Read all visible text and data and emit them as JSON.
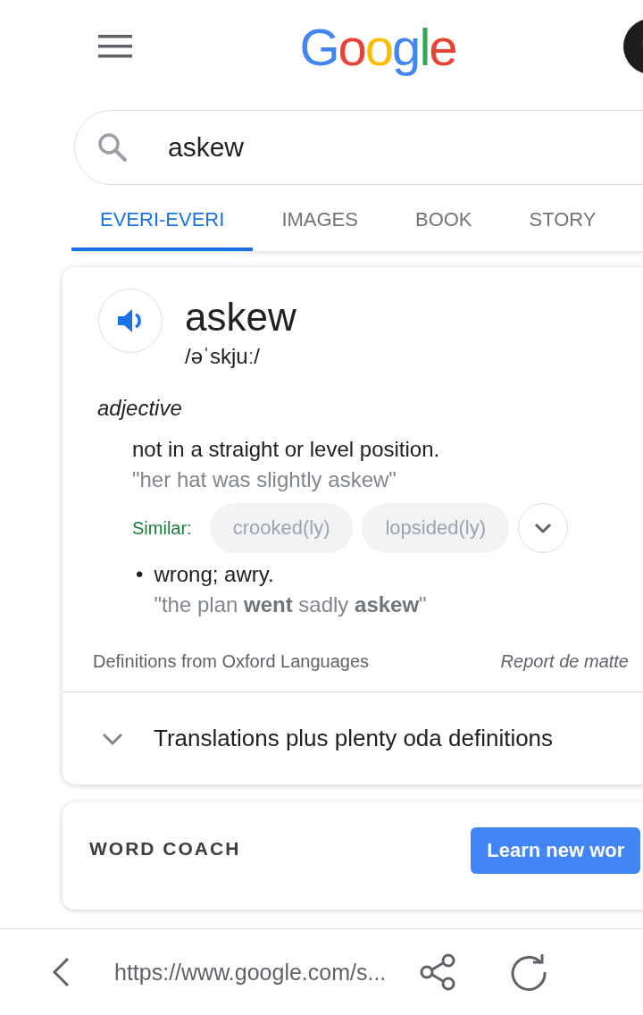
{
  "header": {
    "logo": "Google"
  },
  "search": {
    "value": "askew"
  },
  "tabs": [
    {
      "label": "EVERI-EVERI",
      "selected": true
    },
    {
      "label": "IMAGES",
      "selected": false
    },
    {
      "label": "BOOK",
      "selected": false
    },
    {
      "label": "STORY",
      "selected": false
    }
  ],
  "definition": {
    "word": "askew",
    "phonetic": "/əˈskjuː/",
    "part_of_speech": "adjective",
    "senses": [
      {
        "meaning": "not in a straight or level position.",
        "example": "\"her hat was slightly askew\"",
        "similar_label": "Similar:",
        "similar": [
          "crooked(ly)",
          "lopsided(ly)"
        ]
      },
      {
        "bullet": "•",
        "meaning": "wrong; awry.",
        "example": "\"the plan **went** sadly **askew**\""
      }
    ],
    "source": "Definitions from Oxford Languages",
    "report": "Report de matte",
    "more": "Translations plus plenty oda definitions"
  },
  "word_coach": {
    "title": "WORD COACH",
    "button": "Learn new wor"
  },
  "browser_bar": {
    "url": "https://www.google.com/s..."
  }
}
